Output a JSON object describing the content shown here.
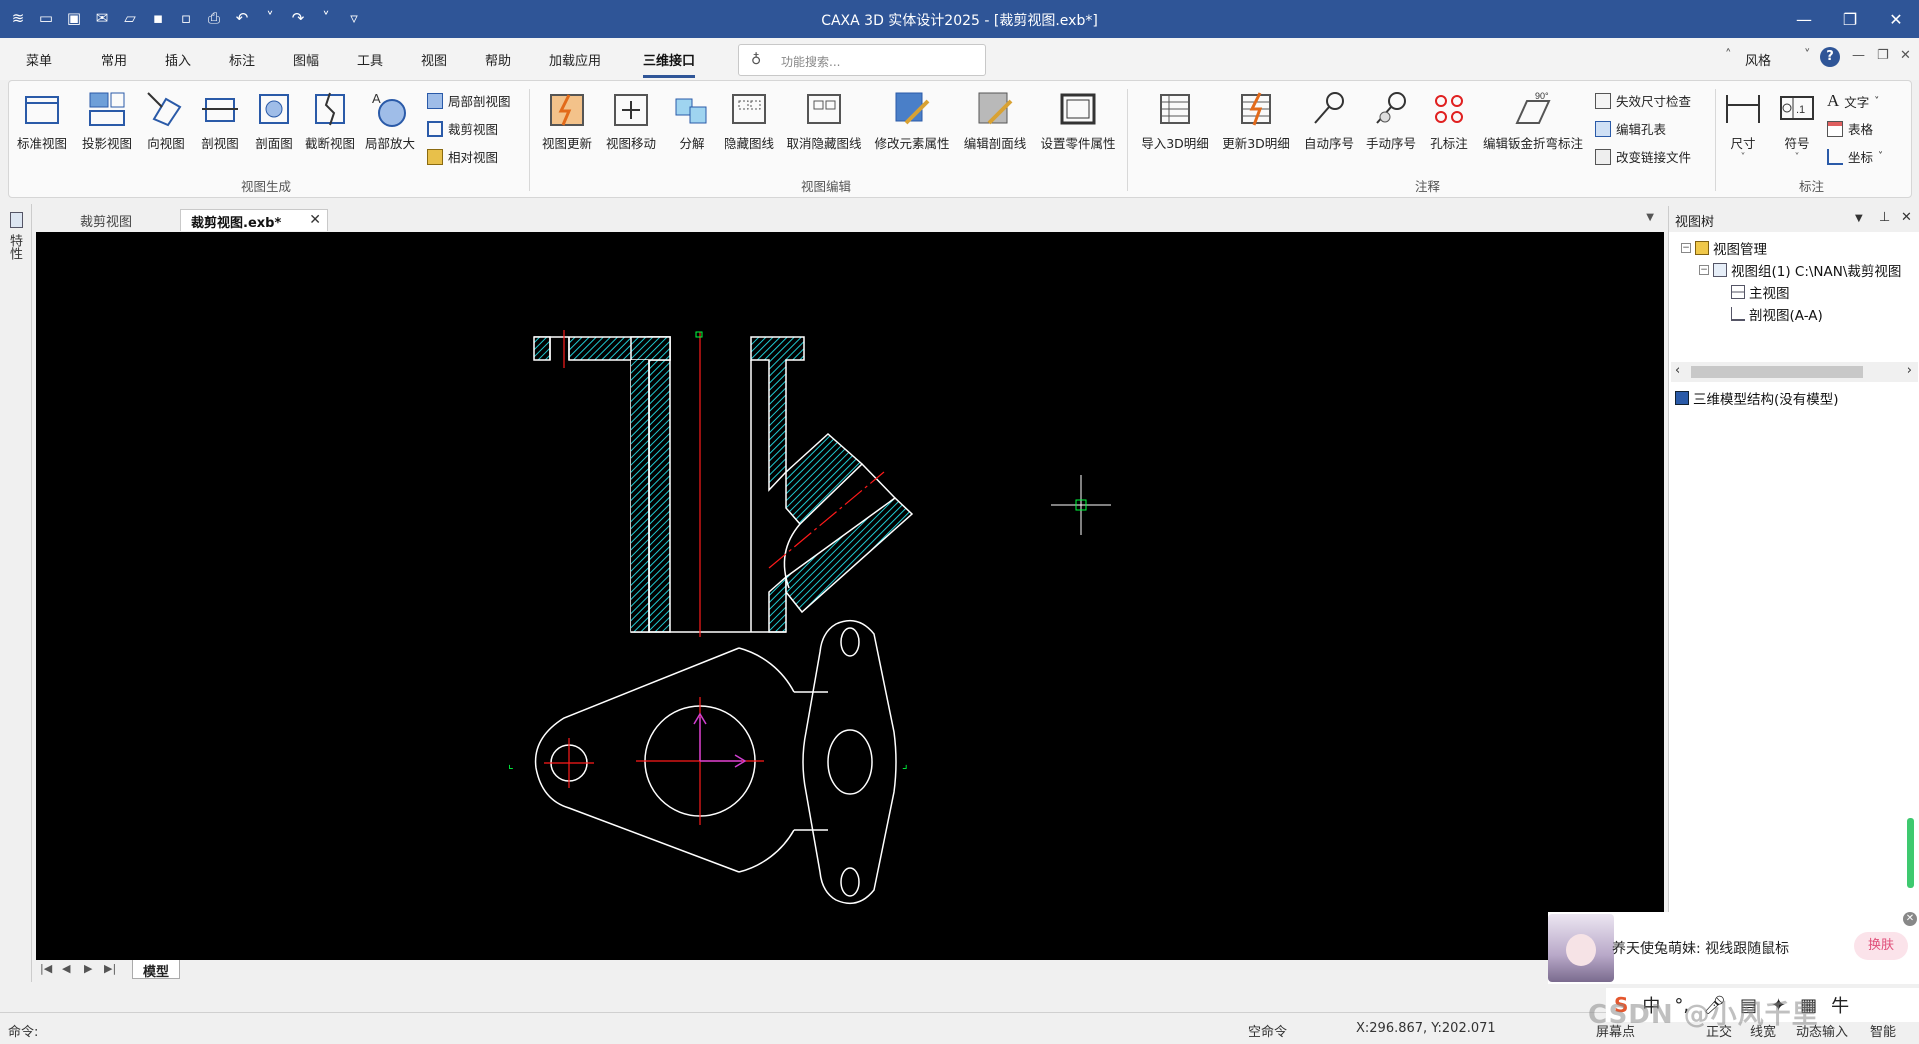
{
  "app": {
    "title": "CAXA 3D 实体设计2025 - [裁剪视图.exb*]"
  },
  "window_controls": {
    "minimize": "—",
    "maximize": "❐",
    "close": "✕"
  },
  "menu": {
    "tabs": [
      "菜单",
      "常用",
      "插入",
      "标注",
      "图幅",
      "工具",
      "视图",
      "帮助",
      "加载应用",
      "三维接口"
    ],
    "active_tab": "三维接口",
    "search_placeholder": "功能搜索...",
    "style_label": "风格"
  },
  "ribbon": {
    "groups": [
      {
        "label": "视图生成",
        "buttons": [
          "标准视图",
          "投影视图",
          "向视图",
          "剖视图",
          "剖面图",
          "截断视图",
          "局部放大"
        ],
        "small_buttons": [
          "局部剖视图",
          "裁剪视图",
          "相对视图"
        ]
      },
      {
        "label": "视图编辑",
        "buttons": [
          "视图更新",
          "视图移动",
          "分解",
          "隐藏图线",
          "取消隐藏图线",
          "修改元素属性",
          "编辑剖面线",
          "设置零件属性"
        ]
      },
      {
        "label": "注释",
        "buttons": [
          "导入3D明细",
          "更新3D明细",
          "自动序号",
          "手动序号",
          "孔标注",
          "编辑钣金折弯标注"
        ],
        "small_buttons": [
          "失效尺寸检查",
          "编辑孔表",
          "改变链接文件"
        ]
      },
      {
        "label": "标注",
        "buttons": [
          "尺寸",
          "符号"
        ],
        "small_buttons": [
          "文字",
          "表格",
          "坐标"
        ]
      }
    ]
  },
  "left_dock": {
    "label": "特性"
  },
  "doc_tabs": {
    "inactive": "裁剪视图",
    "active": "裁剪视图.exb*"
  },
  "view_tree": {
    "title": "视图树",
    "root": "视图管理",
    "group": "视图组(1)  C:\\NAN\\裁剪视图",
    "children": [
      "主视图",
      "剖视图(A-A)"
    ],
    "model_structure": "三维模型结构(没有模型)"
  },
  "sheet_tab": "模型",
  "status": {
    "command_prompt": "命令:",
    "command_state": "空命令",
    "coordinates": "X:296.867, Y:202.071",
    "snap": "屏幕点",
    "ortho": "正交",
    "linewidth": "线宽",
    "dynamic_input": "动态输入",
    "view_mode": "智能"
  },
  "assistant": {
    "message": "养天使兔萌妹: 视线跟随鼠标",
    "button": "换肤"
  },
  "ime": {
    "chars": [
      "中",
      "°,",
      "🎤",
      "▤",
      "✦",
      "▦",
      "牛"
    ]
  },
  "watermark": "CSDN @小风千里",
  "colors": {
    "title_bar": "#2f5597",
    "canvas_bg": "#000000",
    "hatch": "#20c8d0",
    "centerline": "#ff1a1a",
    "outline": "#ffffff",
    "ucs": "#d040d0",
    "marker": "#00ff40"
  }
}
